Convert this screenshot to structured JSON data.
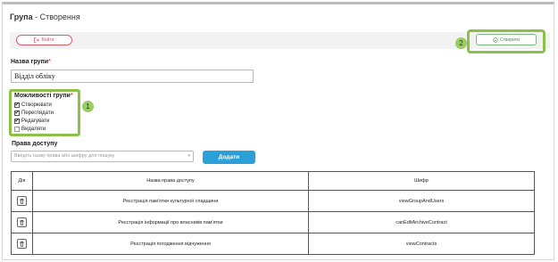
{
  "header": {
    "title_main": "Група",
    "title_sep": " - ",
    "title_sub": "Створення"
  },
  "actions": {
    "exit_label": "Вийти",
    "create_label": "Створити"
  },
  "markers": {
    "one": "1",
    "two": "2"
  },
  "group_name": {
    "label": "Назва групи",
    "required": "*",
    "value": "Відділ обліку"
  },
  "capabilities": {
    "label": "Можливості групи",
    "required": "*",
    "items": [
      {
        "label": "Створювати",
        "checked": true
      },
      {
        "label": "Переглядати",
        "checked": true
      },
      {
        "label": "Редагувати",
        "checked": true
      },
      {
        "label": "Видаляти",
        "checked": false
      }
    ]
  },
  "access": {
    "label": "Права доступу",
    "placeholder": "Введіть назву права або шифру для пошуку",
    "add_label": "Додати"
  },
  "table": {
    "headers": [
      "Дія",
      "Назва права доступу",
      "Шифр"
    ],
    "rows": [
      {
        "name": "Реєстрація пам'ятки культурної спадщини",
        "code": "viewGroupAndUsers"
      },
      {
        "name": "Реєстрація інформації про власників пам'ятки",
        "code": "canEditArchiveContract"
      },
      {
        "name": "Реєстрація погодження відчуження",
        "code": "viewContracts"
      }
    ]
  },
  "icons": {
    "exit": "logout-icon",
    "create": "check-circle-icon",
    "delete": "trash-icon",
    "dropdown": "chevron-down-icon"
  },
  "colors": {
    "highlight": "#8cc04b",
    "exit": "#e05b6a",
    "add_button": "#2a9fd8",
    "required": "#d9534f"
  }
}
